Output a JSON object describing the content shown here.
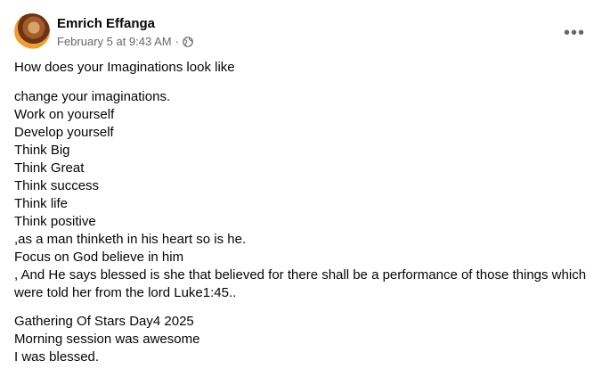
{
  "post": {
    "author": "Emrich Effanga",
    "timestamp": "February 5 at 9:43 AM",
    "separator": "·",
    "privacy_icon": "globe-icon",
    "more_icon": "more-options-icon",
    "more_label": "•••",
    "paragraphs": [
      [
        "How does your Imaginations look like"
      ],
      [
        "change your imaginations.",
        "Work on  yourself",
        "Develop yourself",
        "Think Big",
        "Think Great",
        "Think success",
        "Think life",
        "Think positive",
        ",as a man thinketh in his heart so is he.",
        "Focus on God  believe in him",
        ", And He says blessed  is she   that believed for there shall be a performance of those things which were told her from the lord Luke1:45.."
      ],
      [
        "Gathering Of Stars Day4 2025",
        "Morning session was awesome",
        "I was blessed."
      ]
    ]
  }
}
